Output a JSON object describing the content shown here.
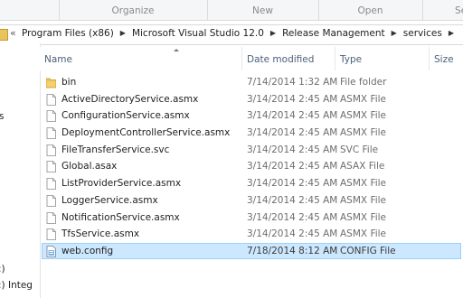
{
  "toolbar": {
    "organize": "Organize",
    "new": "New",
    "open": "Open",
    "select": "Se"
  },
  "address": {
    "overflow": "«",
    "crumbs": [
      "Program Files (x86)",
      "Microsoft Visual Studio 12.0",
      "Release Management",
      "services"
    ]
  },
  "nav": {
    "fragment_1": "s",
    "fragment_2": ":)",
    "fragment_3": ":) Integ"
  },
  "columns": {
    "name": "Name",
    "date": "Date modified",
    "type": "Type",
    "size": "Size"
  },
  "files": [
    {
      "name": "bin",
      "date": "7/14/2014 1:32 AM",
      "type": "File folder",
      "icon": "folder-icon"
    },
    {
      "name": "ActiveDirectoryService.asmx",
      "date": "3/14/2014 2:45 AM",
      "type": "ASMX File",
      "icon": "file-icon"
    },
    {
      "name": "ConfigurationService.asmx",
      "date": "3/14/2014 2:45 AM",
      "type": "ASMX File",
      "icon": "file-icon"
    },
    {
      "name": "DeploymentControllerService.asmx",
      "date": "3/14/2014 2:45 AM",
      "type": "ASMX File",
      "icon": "file-icon"
    },
    {
      "name": "FileTransferService.svc",
      "date": "3/14/2014 2:45 AM",
      "type": "SVC File",
      "icon": "file-icon"
    },
    {
      "name": "Global.asax",
      "date": "3/14/2014 2:45 AM",
      "type": "ASAX File",
      "icon": "file-icon"
    },
    {
      "name": "ListProviderService.asmx",
      "date": "3/14/2014 2:45 AM",
      "type": "ASMX File",
      "icon": "file-icon"
    },
    {
      "name": "LoggerService.asmx",
      "date": "3/14/2014 2:45 AM",
      "type": "ASMX File",
      "icon": "file-icon"
    },
    {
      "name": "NotificationService.asmx",
      "date": "3/14/2014 2:45 AM",
      "type": "ASMX File",
      "icon": "file-icon"
    },
    {
      "name": "TfsService.asmx",
      "date": "3/14/2014 2:45 AM",
      "type": "ASMX File",
      "icon": "file-icon"
    },
    {
      "name": "web.config",
      "date": "7/18/2014 8:12 AM",
      "type": "CONFIG File",
      "icon": "config-file-icon",
      "selected": true
    }
  ],
  "colors": {
    "selection_fill": "#cce8ff",
    "selection_border": "#99d1ff",
    "header_text": "#4c607a",
    "folder": "#e9c35c"
  }
}
